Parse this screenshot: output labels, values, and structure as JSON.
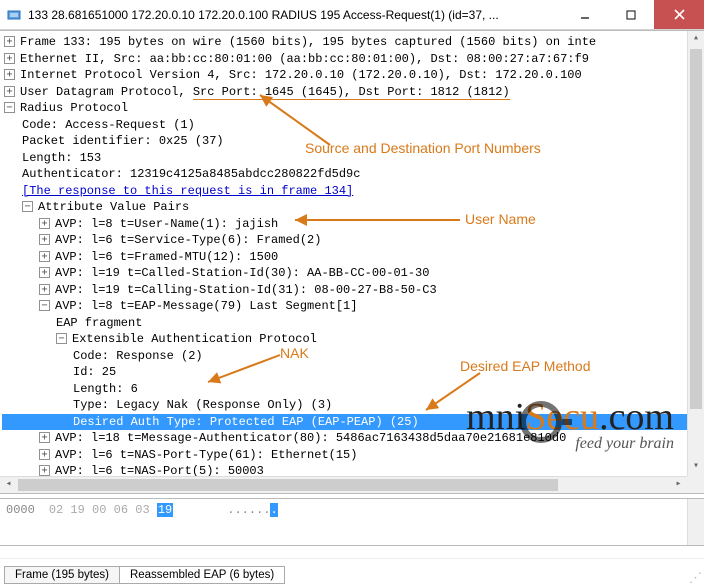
{
  "window": {
    "title": "133 28.681651000 172.20.0.10 172.20.0.100 RADIUS 195 Access-Request(1) (id=37, ..."
  },
  "annotations": {
    "ports": "Source and Destination Port Numbers",
    "user": "User Name",
    "nak": "NAK",
    "eap": "Desired EAP Method"
  },
  "tree": {
    "frame": "Frame 133: 195 bytes on wire (1560 bits), 195 bytes captured (1560 bits) on inte",
    "eth": "Ethernet II, Src: aa:bb:cc:80:01:00 (aa:bb:cc:80:01:00), Dst: 08:00:27:a7:67:f9",
    "ip": "Internet Protocol Version 4, Src: 172.20.0.10 (172.20.0.10), Dst: 172.20.0.100",
    "udp_pre": "User Datagram Protocol, ",
    "udp_ports": "Src Port: 1645 (1645), Dst Port: 1812 (1812)",
    "radius": "Radius Protocol",
    "code": "Code: Access-Request (1)",
    "pid": "Packet identifier: 0x25 (37)",
    "len": "Length: 153",
    "auth": "Authenticator: 12319c4125a8485abdcc280822fd5d9c",
    "resp_link": "[The response to this request is in frame 134]",
    "avp_hdr": "Attribute Value Pairs",
    "avp1": "AVP: l=8 t=User-Name(1): jajish",
    "avp2": "AVP: l=6 t=Service-Type(6): Framed(2)",
    "avp3": "AVP: l=6 t=Framed-MTU(12): 1500",
    "avp4": "AVP: l=19 t=Called-Station-Id(30): AA-BB-CC-00-01-30",
    "avp5": "AVP: l=19 t=Calling-Station-Id(31): 08-00-27-B8-50-C3",
    "avp6": "AVP: l=8 t=EAP-Message(79) Last Segment[1]",
    "eap_frag": "EAP fragment",
    "eap_proto": "Extensible Authentication Protocol",
    "eap_code": "Code: Response (2)",
    "eap_id": "Id: 25",
    "eap_len": "Length: 6",
    "eap_type": "Type: Legacy Nak (Response Only) (3)",
    "eap_desired": "Desired Auth Type: Protected EAP (EAP-PEAP) (25)",
    "avp7": "AVP: l=18 t=Message-Authenticator(80): 5486ac7163438d5daa70e21681e810d0",
    "avp8": "AVP: l=6 t=NAS-Port-Type(61): Ethernet(15)",
    "avp9": "AVP: l=6 t=NAS-Port(5): 50003"
  },
  "hex": {
    "offset": "0000",
    "b0": "02",
    "b1": "19",
    "b2": "00",
    "b3": "06",
    "b4": "03",
    "b5": "19",
    "ascii_dots": "......",
    "ascii_sel": "."
  },
  "tabs": {
    "t1": "Frame (195 bytes)",
    "t2": "Reassembled EAP (6 bytes)"
  },
  "watermark": {
    "text1": "mni",
    "text2": "Secu",
    "text3": ".com",
    "sub": "feed your brain"
  }
}
